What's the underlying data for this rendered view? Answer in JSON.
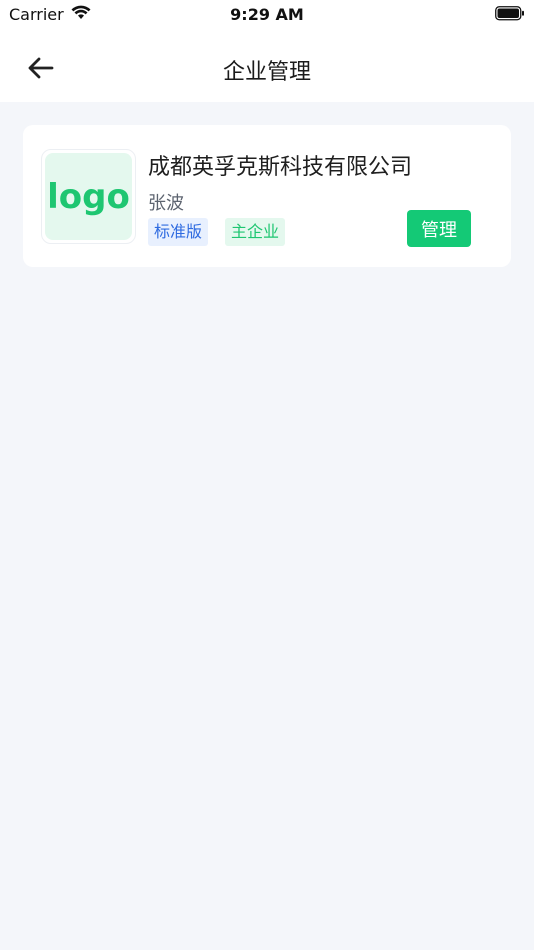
{
  "status_bar": {
    "carrier": "Carrier",
    "time": "9:29 AM"
  },
  "nav": {
    "title": "企业管理",
    "back_icon": "arrow-left-icon"
  },
  "company": {
    "logo_text": "logo",
    "name": "成都英孚克斯科技有限公司",
    "person": "张波",
    "tags": [
      "标准版",
      "主企业"
    ],
    "manage_label": "管理"
  },
  "colors": {
    "accent": "#14c976",
    "tag_blue": "#2f6be0",
    "background": "#f4f6fa"
  }
}
